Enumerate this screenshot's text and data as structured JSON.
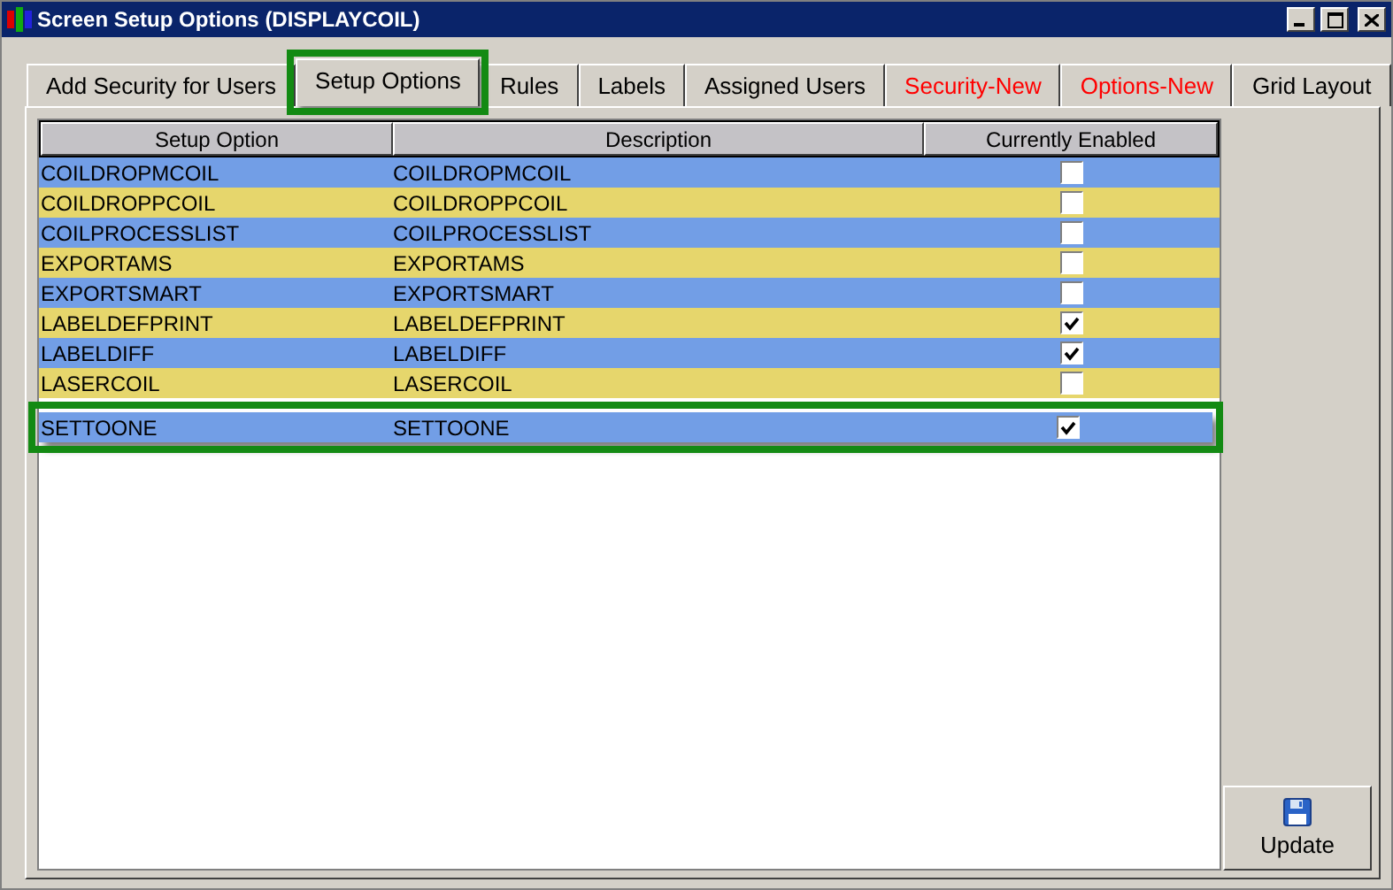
{
  "window": {
    "title": "Screen Setup Options (DISPLAYCOIL)"
  },
  "tabs": [
    {
      "label": "Add Security for Users",
      "selected": false,
      "highlighted": false,
      "kind": "normal"
    },
    {
      "label": "Setup Options",
      "selected": true,
      "highlighted": true,
      "kind": "normal"
    },
    {
      "label": "Rules",
      "selected": false,
      "highlighted": false,
      "kind": "normal"
    },
    {
      "label": "Labels",
      "selected": false,
      "highlighted": false,
      "kind": "normal"
    },
    {
      "label": "Assigned Users",
      "selected": false,
      "highlighted": false,
      "kind": "normal"
    },
    {
      "label": "Security-New",
      "selected": false,
      "highlighted": false,
      "kind": "new"
    },
    {
      "label": "Options-New",
      "selected": false,
      "highlighted": false,
      "kind": "new"
    },
    {
      "label": "Grid Layout",
      "selected": false,
      "highlighted": false,
      "kind": "normal"
    }
  ],
  "table": {
    "columns": [
      "Setup Option",
      "Description",
      "Currently Enabled"
    ],
    "rows": [
      {
        "option": "COILDROPMCOIL",
        "description": "COILDROPMCOIL",
        "checked": false,
        "highlighted": false
      },
      {
        "option": "COILDROPPCOIL",
        "description": "COILDROPPCOIL",
        "checked": false,
        "highlighted": false
      },
      {
        "option": "COILPROCESSLIST",
        "description": "COILPROCESSLIST",
        "checked": false,
        "highlighted": false
      },
      {
        "option": "EXPORTAMS",
        "description": "EXPORTAMS",
        "checked": false,
        "highlighted": false
      },
      {
        "option": "EXPORTSMART",
        "description": "EXPORTSMART",
        "checked": false,
        "highlighted": false
      },
      {
        "option": "LABELDEFPRINT",
        "description": "LABELDEFPRINT",
        "checked": true,
        "highlighted": false
      },
      {
        "option": "LABELDIFF",
        "description": "LABELDIFF",
        "checked": true,
        "highlighted": false
      },
      {
        "option": "LASERCOIL",
        "description": "LASERCOIL",
        "checked": false,
        "highlighted": false
      },
      {
        "option": "SETTOONE",
        "description": "SETTOONE",
        "checked": true,
        "highlighted": true
      }
    ]
  },
  "update_button": {
    "label": "Update"
  }
}
